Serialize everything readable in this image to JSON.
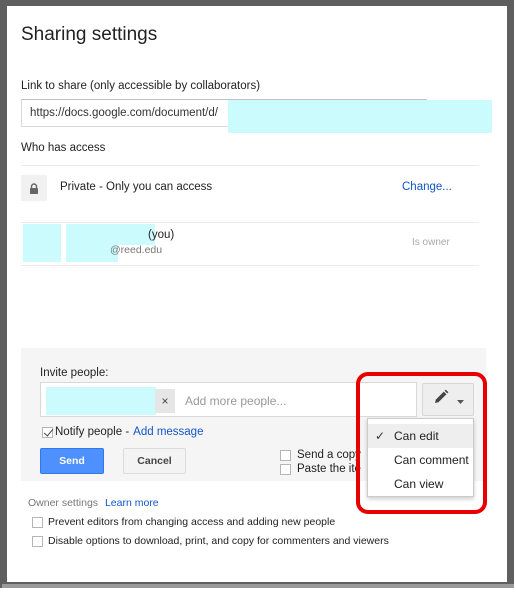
{
  "dialog": {
    "title": "Sharing settings"
  },
  "link": {
    "label": "Link to share (only accessible by collaborators)",
    "value": "https://docs.google.com/document/d/"
  },
  "access": {
    "label": "Who has access",
    "visibility": "Private - Only you can access",
    "change_label": "Change...",
    "owner": {
      "you_suffix": "(you)",
      "email_domain": "@reed.edu",
      "role": "Is owner"
    }
  },
  "invite": {
    "label": "Invite people:",
    "remove_chip": "×",
    "placeholder": "Add more people...",
    "notify_label": "Notify people -",
    "notify_checked": true,
    "add_message": "Add message",
    "send": "Send",
    "cancel": "Cancel",
    "options": [
      {
        "label": "Send a copy",
        "checked": false
      },
      {
        "label": "Paste the ite",
        "checked": false
      }
    ]
  },
  "role_menu": {
    "current_icon": "pencil-icon",
    "items": [
      {
        "label": "Can edit",
        "selected": true
      },
      {
        "label": "Can comment",
        "selected": false
      },
      {
        "label": "Can view",
        "selected": false
      }
    ]
  },
  "owner_settings": {
    "label": "Owner settings",
    "learn_more": "Learn more",
    "options": [
      {
        "label": "Prevent editors from changing access and adding new people",
        "checked": false
      },
      {
        "label": "Disable options to download, print, and copy for commenters and viewers",
        "checked": false
      }
    ]
  },
  "colors": {
    "link": "#1155cc",
    "primary_button": "#4d90fe",
    "annotation": "#e80000",
    "redaction": "#ccfbfd"
  }
}
